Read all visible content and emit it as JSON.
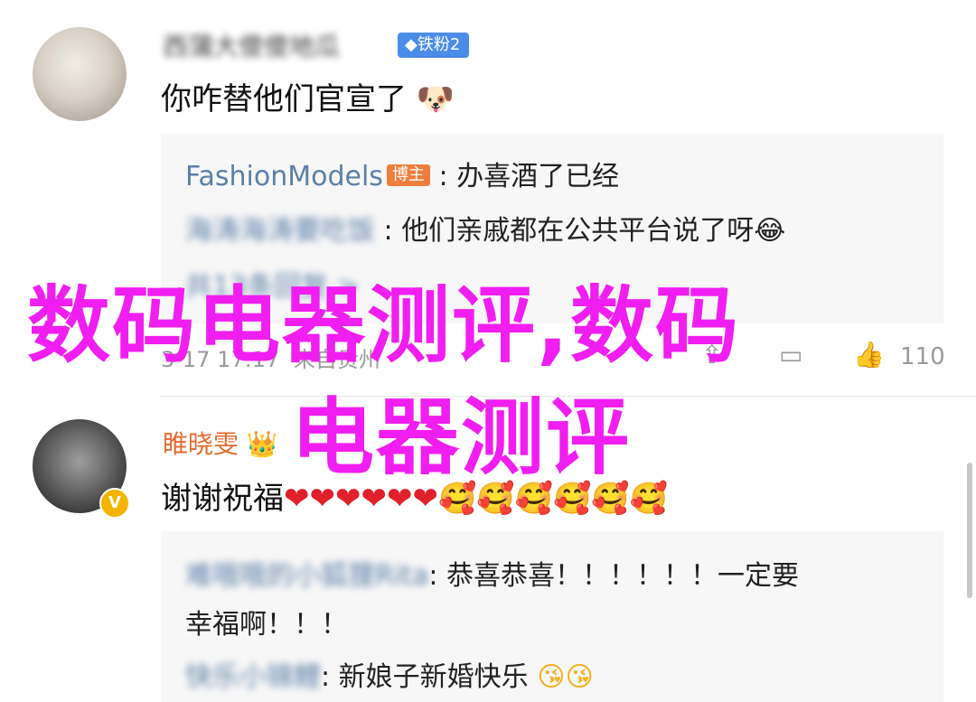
{
  "comment1": {
    "username": "西蒲大傻傻地瓜",
    "level_badge": "◆铁粉2",
    "text": "你咋替他们官宣了",
    "emoji": "dog-face"
  },
  "replies1": [
    {
      "name": "FashionModels",
      "tag": "博主",
      "text": ": 办喜酒了已经"
    },
    {
      "name": "海涛海涛要吃饭",
      "text": ": 他们亲戚都在公共平台说了呀😂"
    },
    {
      "summary": "共13条回复 >"
    }
  ],
  "meta": {
    "time": "3-17 17:17",
    "source": "来自贵州",
    "likes": "110"
  },
  "comment2": {
    "username": "睢晓雯",
    "crown": "👑",
    "text": "谢谢祝福",
    "hearts": "❤❤❤❤❤❤",
    "faces": "🥰🥰🥰🥰🥰🥰"
  },
  "replies2": [
    {
      "name": "难哦哦的小狐狸Rita",
      "text": ": 恭喜恭喜！！！！！！一定要"
    },
    {
      "text": "幸福啊！！！"
    },
    {
      "name": "快乐小锦鲤",
      "text": ": 新娘子新婚快乐",
      "faces": "😘😘"
    }
  ],
  "watermark": {
    "line1": "数码电器测评,数码",
    "line2": "电器测评"
  }
}
